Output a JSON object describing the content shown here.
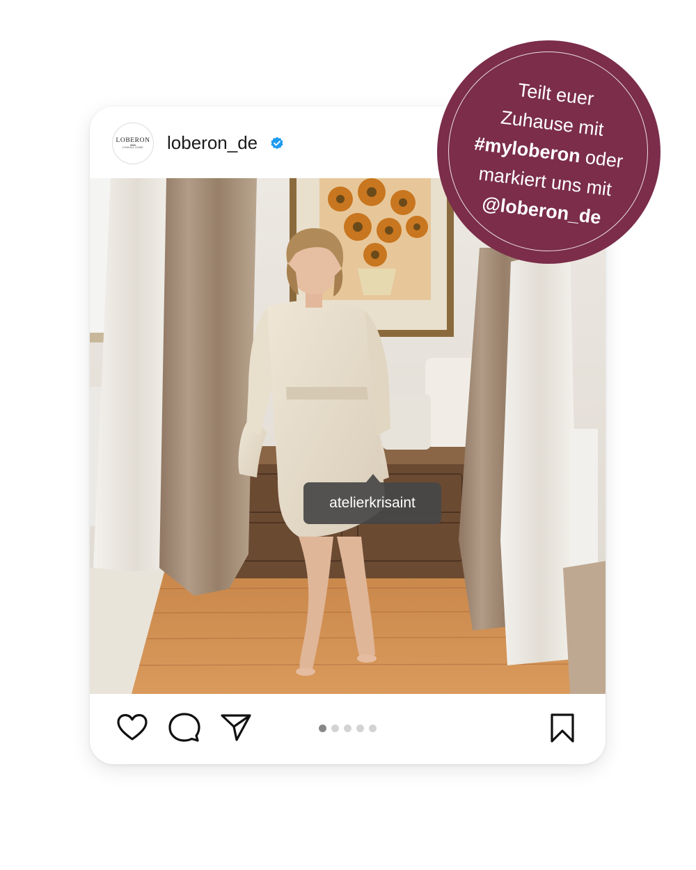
{
  "post": {
    "username": "loberon_de",
    "verified_icon": "verified-badge-icon",
    "avatar": {
      "brand": "LOBERON",
      "tagline": "COMING HOME"
    },
    "tag_label": "atelierkrisaint",
    "carousel": {
      "total": 5,
      "active_index": 0
    }
  },
  "actions": {
    "like_icon": "heart-icon",
    "comment_icon": "comment-icon",
    "share_icon": "send-icon",
    "save_icon": "bookmark-icon"
  },
  "badge": {
    "line1": "Teilt euer",
    "line2": "Zuhause mit",
    "hashtag": "#myloberon",
    "line3_rest": " oder",
    "line4": "markiert uns mit",
    "handle": "@loberon_de",
    "color": "#7b2d4a"
  }
}
